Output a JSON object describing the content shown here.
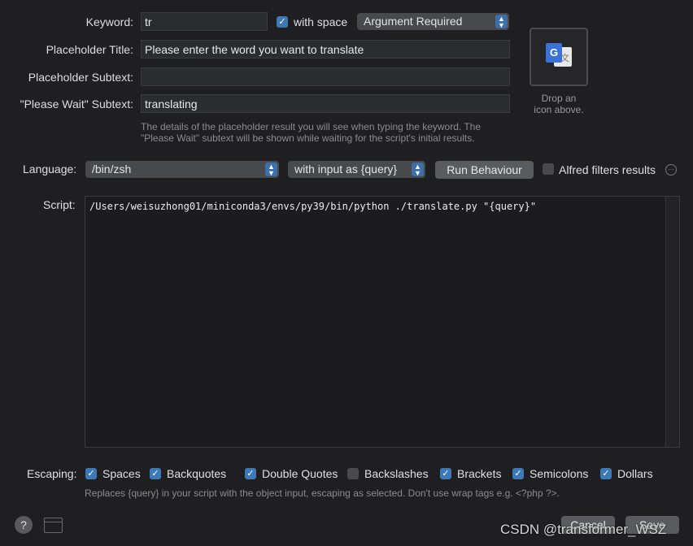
{
  "keyword": {
    "label": "Keyword:",
    "value": "tr",
    "with_space_label": "with space",
    "with_space_checked": true,
    "argument_select": "Argument Required"
  },
  "placeholder_title": {
    "label": "Placeholder Title:",
    "value": "Please enter the word you want to translate"
  },
  "placeholder_subtext": {
    "label": "Placeholder Subtext:",
    "value": ""
  },
  "please_wait": {
    "label": "\"Please Wait\" Subtext:",
    "value": "translating"
  },
  "placeholder_hint": "The details of the placeholder result you will see when typing the keyword. The \"Please Wait\" subtext will be shown while waiting for the script's initial results.",
  "icon_well": {
    "hint_line1": "Drop an",
    "hint_line2": "icon above.",
    "icon": "google-translate-icon"
  },
  "language": {
    "label": "Language:",
    "value": "/bin/zsh",
    "input_mode": "with input as {query}",
    "run_behaviour": "Run Behaviour",
    "alfred_filters_label": "Alfred filters results",
    "alfred_filters_checked": false
  },
  "script": {
    "label": "Script:",
    "value": "/Users/weisuzhong01/miniconda3/envs/py39/bin/python ./translate.py \"{query}\""
  },
  "escaping": {
    "label": "Escaping:",
    "options": [
      {
        "label": "Spaces",
        "checked": true
      },
      {
        "label": "Backquotes",
        "checked": true
      },
      {
        "label": "Double Quotes",
        "checked": true
      },
      {
        "label": "Backslashes",
        "checked": false
      },
      {
        "label": "Brackets",
        "checked": true
      },
      {
        "label": "Semicolons",
        "checked": true
      },
      {
        "label": "Dollars",
        "checked": true
      }
    ],
    "hint": "Replaces {query} in your script with the object input, escaping as selected. Don't use wrap tags e.g. <?php ?>."
  },
  "footer": {
    "help": "?",
    "cancel": "Cancel",
    "save": "Save",
    "watermark": "CSDN @transformer_WSZ"
  }
}
